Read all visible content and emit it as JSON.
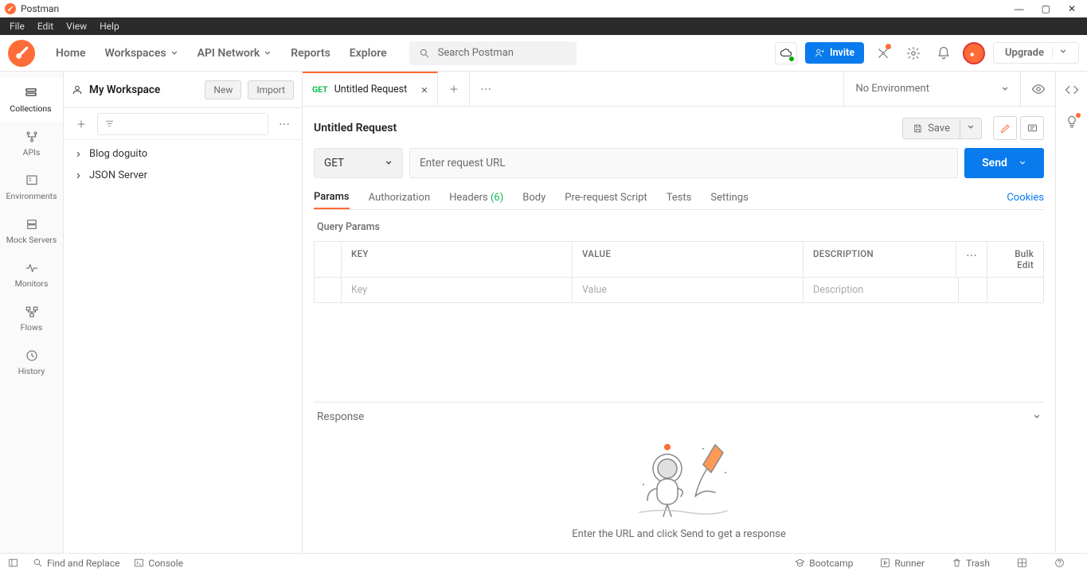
{
  "titlebar": {
    "title": "Postman"
  },
  "menubar": {
    "items": [
      "File",
      "Edit",
      "View",
      "Help"
    ]
  },
  "topnav": {
    "home": "Home",
    "workspaces": "Workspaces",
    "api_network": "API Network",
    "reports": "Reports",
    "explore": "Explore",
    "search_placeholder": "Search Postman",
    "invite": "Invite",
    "upgrade": "Upgrade"
  },
  "workspace": {
    "name": "My Workspace",
    "new_btn": "New",
    "import_btn": "Import"
  },
  "left_rail": {
    "collections": "Collections",
    "apis": "APIs",
    "environments": "Environments",
    "mock": "Mock Servers",
    "monitors": "Monitors",
    "flows": "Flows",
    "history": "History"
  },
  "collections": {
    "items": [
      "Blog doguito",
      "JSON Server"
    ]
  },
  "tabs": {
    "active": {
      "method": "GET",
      "name": "Untitled Request"
    },
    "environment": "No Environment"
  },
  "request": {
    "title": "Untitled Request",
    "save": "Save",
    "method": "GET",
    "url_placeholder": "Enter request URL",
    "send": "Send",
    "tabs": {
      "params": "Params",
      "auth": "Authorization",
      "headers": "Headers",
      "headers_count": "(6)",
      "body": "Body",
      "prerequest": "Pre-request Script",
      "tests": "Tests",
      "settings": "Settings"
    },
    "cookies": "Cookies",
    "query_params_label": "Query Params",
    "table_head": {
      "key": "KEY",
      "value": "VALUE",
      "desc": "DESCRIPTION",
      "bulk": "Bulk Edit"
    },
    "table_placeholders": {
      "key": "Key",
      "value": "Value",
      "desc": "Description"
    }
  },
  "response": {
    "label": "Response",
    "empty_msg": "Enter the URL and click Send to get a response"
  },
  "footer": {
    "find": "Find and Replace",
    "console": "Console",
    "bootcamp": "Bootcamp",
    "runner": "Runner",
    "trash": "Trash"
  }
}
